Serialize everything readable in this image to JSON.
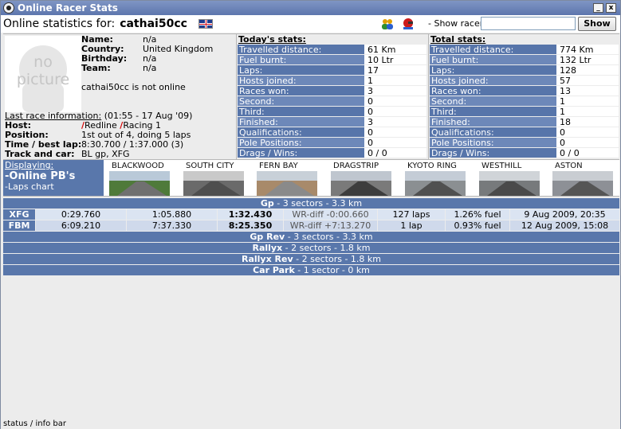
{
  "window": {
    "title": "Online Racer Stats",
    "minimize": "_",
    "close": "x"
  },
  "header": {
    "label": "Online statistics for:",
    "racer": "cathai50cc",
    "show_racer_label": "- Show racer:",
    "show_racer_value": "",
    "show_button": "Show"
  },
  "profile": {
    "picture_text_1": "no",
    "picture_text_2": "picture",
    "fields": [
      {
        "label": "Name:",
        "value": "n/a"
      },
      {
        "label": "Country:",
        "value": "United Kingdom"
      },
      {
        "label": "Birthday:",
        "value": "n/a"
      },
      {
        "label": "Team:",
        "value": "n/a"
      }
    ],
    "online_status": "cathai50cc is not online",
    "last_race_label": "Last race information:",
    "last_race_time": "(01:55 - 17 Aug '09)",
    "last_race": [
      {
        "label": "Host:",
        "value": "Redline Racing 1"
      },
      {
        "label": "Position:",
        "value": "1st out of 4, doing 5 laps"
      },
      {
        "label": "Time / best lap:",
        "value": "8:30.700 / 1:37.000 (3)"
      },
      {
        "label": "Track and car:",
        "value": "BL gp, XFG"
      }
    ],
    "host_parts": [
      "/",
      "R",
      "edline ",
      "/",
      "R",
      "acing 1"
    ]
  },
  "today_stats": {
    "title": "Today's stats:",
    "rows": [
      {
        "label": "Travelled distance:",
        "value": "61 Km"
      },
      {
        "label": "Fuel burnt:",
        "value": "10 Ltr"
      },
      {
        "label": "Laps:",
        "value": "17"
      },
      {
        "label": "Hosts joined:",
        "value": "1"
      },
      {
        "label": "Races won:",
        "value": "3"
      },
      {
        "label": "Second:",
        "value": "0"
      },
      {
        "label": "Third:",
        "value": "0"
      },
      {
        "label": "Finished:",
        "value": "3"
      },
      {
        "label": "Qualifications:",
        "value": "0"
      },
      {
        "label": "Pole Positions:",
        "value": "0"
      },
      {
        "label": "Drags / Wins:",
        "value": "0 / 0"
      }
    ]
  },
  "total_stats": {
    "title": "Total stats:",
    "rows": [
      {
        "label": "Travelled distance:",
        "value": "774 Km"
      },
      {
        "label": "Fuel burnt:",
        "value": "132 Ltr"
      },
      {
        "label": "Laps:",
        "value": "128"
      },
      {
        "label": "Hosts joined:",
        "value": "57"
      },
      {
        "label": "Races won:",
        "value": "13"
      },
      {
        "label": "Second:",
        "value": "1"
      },
      {
        "label": "Third:",
        "value": "1"
      },
      {
        "label": "Finished:",
        "value": "18"
      },
      {
        "label": "Qualifications:",
        "value": "0"
      },
      {
        "label": "Pole Positions:",
        "value": "0"
      },
      {
        "label": "Drags / Wins:",
        "value": "0 / 0"
      }
    ]
  },
  "displaying": {
    "label": "Displaying:",
    "current": "-Online PB's",
    "other": "-Laps chart"
  },
  "tracks": [
    {
      "name": "BLACKWOOD",
      "sky": "#b9c9d8",
      "ground": "#4f7a3a",
      "road": "#707070"
    },
    {
      "name": "SOUTH CITY",
      "sky": "#c9c9c9",
      "ground": "#6a6a6a",
      "road": "#4e4e4e"
    },
    {
      "name": "FERN BAY",
      "sky": "#c8d0d8",
      "ground": "#a88a6a",
      "road": "#8a8a8a"
    },
    {
      "name": "DRAGSTRIP",
      "sky": "#bfc6cf",
      "ground": "#7a7a7a",
      "road": "#3d3d3d"
    },
    {
      "name": "KYOTO RING",
      "sky": "#c4ccd6",
      "ground": "#8b8f92",
      "road": "#505050"
    },
    {
      "name": "WESTHILL",
      "sky": "#d0d4d8",
      "ground": "#777a7c",
      "road": "#4a4a4a"
    },
    {
      "name": "ASTON",
      "sky": "#c9cdd2",
      "ground": "#8d9096",
      "road": "#555555"
    }
  ],
  "results": {
    "sections": [
      {
        "name": "Gp",
        "desc": "3 sectors - 3.3 km"
      },
      {
        "name": "Gp Rev",
        "desc": "3 sectors - 3.3 km"
      },
      {
        "name": "Rallyx",
        "desc": "2 sectors - 1.8 km"
      },
      {
        "name": "Rallyx Rev",
        "desc": "2 sectors - 1.8 km"
      },
      {
        "name": "Car Park",
        "desc": "1 sector - 0 km"
      }
    ],
    "gp_rows": [
      {
        "car": "XFG",
        "s1": "0:29.760",
        "s2": "1:05.880",
        "total": "1:32.430",
        "wrdiff": "WR-diff -0:00.660",
        "laps": "127 laps",
        "fuel": "1.26% fuel",
        "date": "9 Aug 2009, 20:35"
      },
      {
        "car": "FBM",
        "s1": "6:09.210",
        "s2": "7:37.330",
        "total": "8:25.350",
        "wrdiff": "WR-diff +7:13.270",
        "laps": "1 lap",
        "fuel": "0.93% fuel",
        "date": "12 Aug 2009, 15:08"
      }
    ]
  },
  "status_bar": "status / info bar",
  "colors": {
    "title_bar": "#6a82b8",
    "stat_label_bg": "#5775aa",
    "result_row_bg": "#dbe4f2"
  }
}
